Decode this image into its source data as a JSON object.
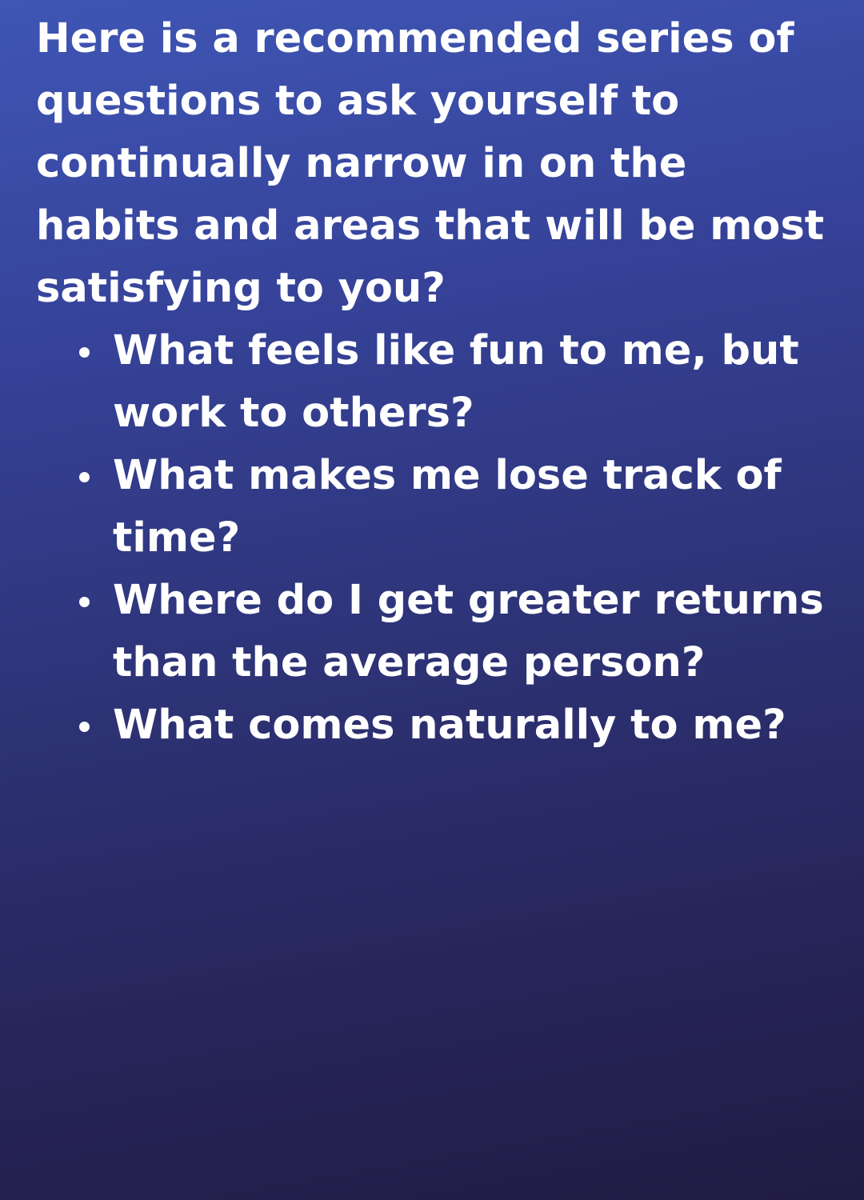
{
  "intro": "Here is a recommended series of questions to ask yourself to continually narrow in on the habits and areas that will be most satisfying to you?",
  "questions": [
    "What feels like fun to me, but work to others?",
    "What makes me lose track of time?",
    "Where do I get greater returns than the average person?",
    "What comes naturally to me?"
  ],
  "colors": {
    "background_top": "#3f56b5",
    "background_bottom": "#211c44",
    "text": "#ffffff"
  }
}
